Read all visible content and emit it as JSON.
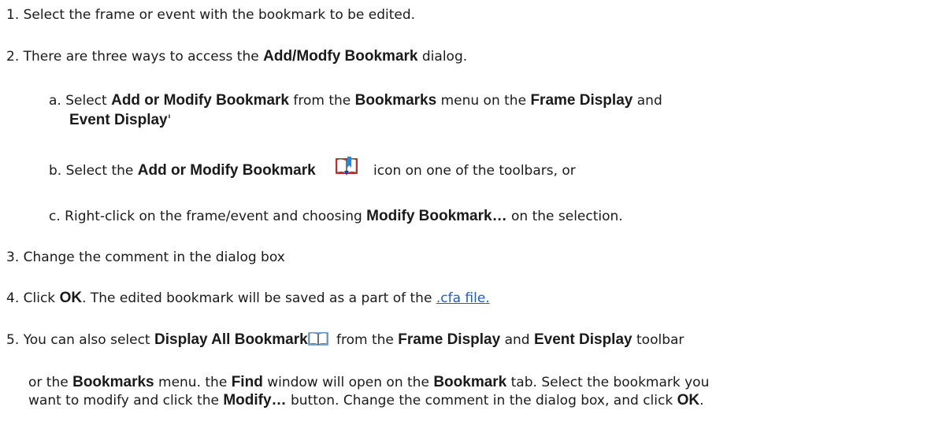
{
  "steps": [
    {
      "num": "1.",
      "text": "Select the frame or event with the bookmark to be edited."
    },
    {
      "num": "2.",
      "pre": "There are three ways to access the ",
      "b1": "Add/Modfy Bookmark",
      "post": " dialog."
    },
    {
      "num": "3.",
      "text": "Change the comment in the dialog box"
    },
    {
      "num": "4.",
      "pre": "Click ",
      "b1": "OK",
      "mid": ". The edited bookmark will be saved as a part of the ",
      "link": ".cfa file."
    },
    {
      "num": "5.",
      "pre": "You can also select ",
      "b1": "Display All Bookmarks",
      "mid": " from the ",
      "b2": "Frame Display",
      "mid2": " and ",
      "b3": "Event Display",
      "post": " toolbar"
    }
  ],
  "substeps": {
    "a": {
      "letter": "a.",
      "pre": "Select ",
      "b1": "Add or Modify Bookmark",
      "mid": " from the ",
      "b2": "Bookmarks",
      "mid2": " menu on the ",
      "b3": "Frame Display",
      "post": " and",
      "line2_b": "Event Display",
      "line2_post": "'"
    },
    "b": {
      "letter": "b.",
      "pre": "Select the ",
      "b1": "Add or Modify Bookmark",
      "post": " icon on one of the toolbars, or"
    },
    "c": {
      "letter": "c.",
      "pre": "Right-click on the frame/event and choosing ",
      "b1": "Modify Bookmark…",
      "post": " on the selection."
    }
  },
  "step5_continued": {
    "line1_pre": "or the ",
    "line1_b1": "Bookmarks",
    "line1_mid": " menu. the ",
    "line1_b2": "Find",
    "line1_mid2": " window will open on the ",
    "line1_b3": "Bookmark",
    "line1_post": " tab. Select the bookmark you",
    "line2_pre": "want to modify and click the ",
    "line2_b1": "Modify…",
    "line2_mid": " button. Change the comment in the dialog box, and click ",
    "line2_b2": "OK",
    "line2_post": "."
  },
  "icons": {
    "add_modify": "add-modify-bookmark-icon",
    "display_all": "display-all-bookmarks-icon"
  }
}
